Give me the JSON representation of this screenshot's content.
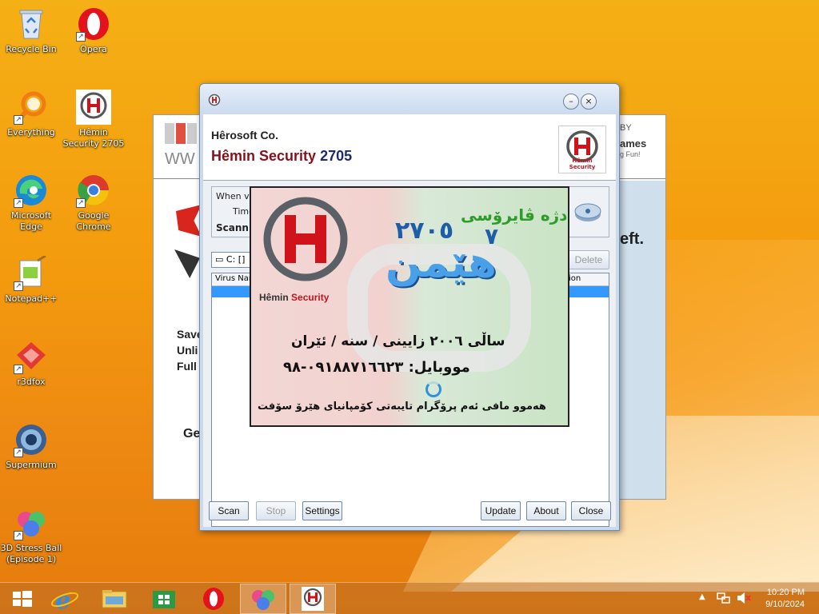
{
  "desktop": {
    "icons": [
      {
        "label": "Recycle Bin"
      },
      {
        "label": "Opera"
      },
      {
        "label": "Everything"
      },
      {
        "label": "Hêmin Security 2705"
      },
      {
        "label": "Microsoft Edge"
      },
      {
        "label": "Google Chrome"
      },
      {
        "label": "Notepad++"
      },
      {
        "label": "r3dfox"
      },
      {
        "label": "Supermium"
      },
      {
        "label": "3D Stress Ball (Episode 1)"
      }
    ]
  },
  "background_window": {
    "brand_partial": "WW",
    "by_text": "BY",
    "games_text": "ames",
    "fun_text": "g Fun!",
    "left_text": "eft.",
    "lines": [
      "Save",
      "Unli",
      "Full"
    ],
    "footer_partial": "Ge"
  },
  "app": {
    "company": "Hêrosoft Co.",
    "product": "Hêmin Security",
    "version": "2705",
    "logo_caption": "Hêmin Security",
    "group": {
      "when_label": "When vir",
      "time_label": "Time",
      "scanning_label": "Scanni"
    },
    "drive_label": "C: []",
    "delete_button": "Delete",
    "list_columns": {
      "virus_name": "Virus Nam",
      "action": "ion"
    },
    "buttons": {
      "scan": "Scan",
      "stop": "Stop",
      "settings": "Settings",
      "update": "Update",
      "about": "About",
      "close": "Close"
    },
    "titlebar_buttons": {
      "minimize": "–",
      "close": "×"
    }
  },
  "splash": {
    "logo_caption_first": "Hêmin",
    "logo_caption_second": "Security",
    "headline": "دژە ڤایرۆسی",
    "version_digit": "٧",
    "number": "٢٧٠٥",
    "name": "هێمن",
    "year_line": "ساڵی ٢٠٠٦ زایینی / سنە / ئێران",
    "mobile_line": "مووبایل: ٠٩١٨٨٧١٦٦٢٣-٩٨",
    "rights_line": "هەموو مافی ئەم پرۆگرام تایبەتی کۆمپانیای هێرۆ سۆفت"
  },
  "taskbar": {
    "time": "10:20 PM",
    "date": "9/10/2024"
  },
  "colors": {
    "product_red": "#8b0f1a",
    "version_navy": "#1d2b6e",
    "selection_blue": "#3399ff"
  }
}
